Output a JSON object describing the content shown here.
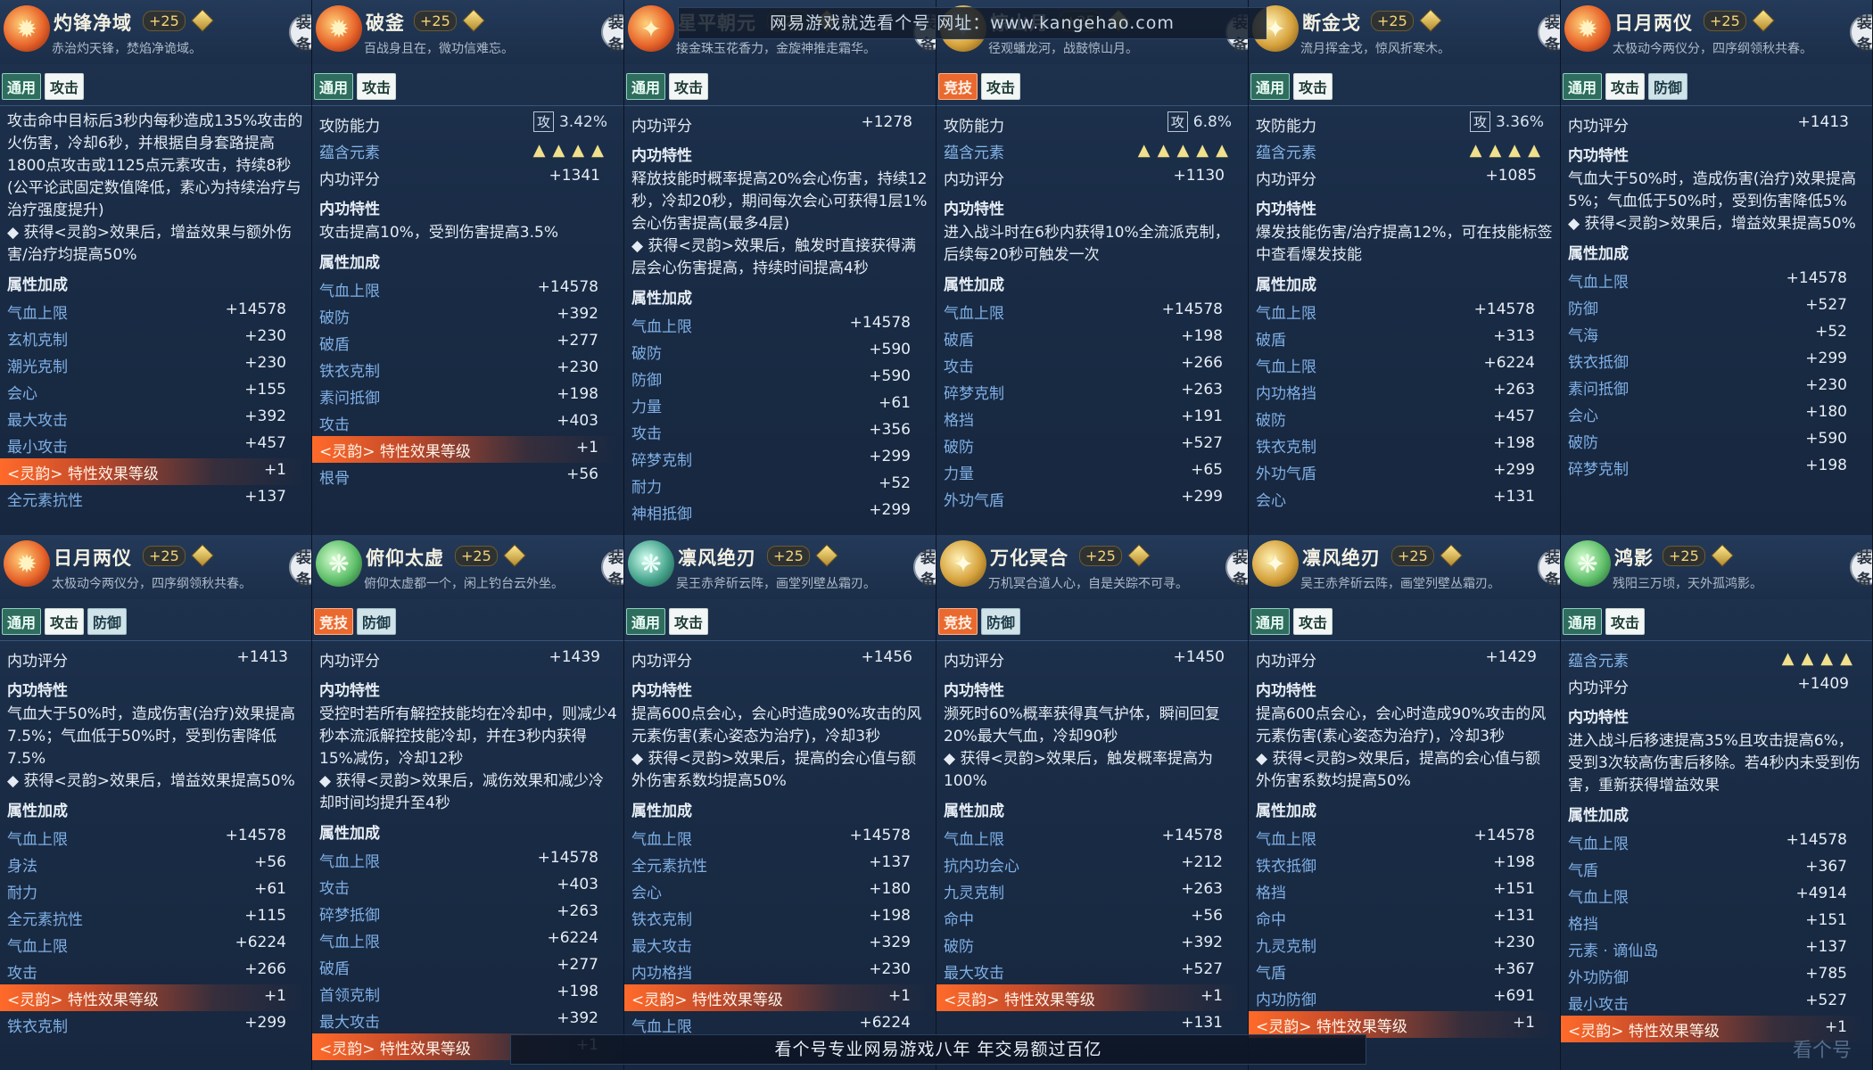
{
  "watermark_top": "网易游戏就选看个号  网址：www.kangehao.com",
  "watermark_bottom": "看个号专业网易游戏八年  年交易额过百亿",
  "corner_logo": "看个号",
  "equip_label": "装备",
  "panels": [
    {
      "title": "灼锋净域",
      "plus": "+25",
      "subtitle": "赤治灼天锋，焚焰净诡域。",
      "tags": [
        "通用",
        "攻击"
      ],
      "desc": "攻击命中目标后3秒内每秒造成135%攻击的火伤害，冷却6秒，并根据自身套路提高1800点攻击或1125点元素攻击，持续8秒(公平论武固定数值降低，素心为持续治疗与治疗强度提升)",
      "desc_extra": "◆ 获得<灵韵>效果后，增益效果与额外伤害/治疗均提高50%",
      "attr_header": "属性加成",
      "stats": [
        [
          "气血上限",
          "+14578"
        ],
        [
          "玄机克制",
          "+230"
        ],
        [
          "潮光克制",
          "+230"
        ],
        [
          "会心",
          "+155"
        ],
        [
          "最大攻击",
          "+392"
        ],
        [
          "最小攻击",
          "+457"
        ],
        [
          "<灵韵> 特性效果等级",
          "+1"
        ],
        [
          "全元素抗性",
          "+137"
        ]
      ]
    },
    {
      "title": "破釜",
      "plus": "+25",
      "subtitle": "百战身且在，微功信难忘。",
      "tags": [
        "通用",
        "攻击"
      ],
      "rating_label": "攻防能力",
      "rating_badge": "攻",
      "rating_value": "3.42%",
      "element_label": "蕴含元素",
      "element_stars": "▲▲▲▲",
      "score_label": "内功评分",
      "score_value": "+1341",
      "trait_label": "内功特性",
      "desc": "攻击提高10%，受到伤害提高3.5%",
      "attr_header": "属性加成",
      "stats": [
        [
          "气血上限",
          "+14578"
        ],
        [
          "破防",
          "+392"
        ],
        [
          "破盾",
          "+277"
        ],
        [
          "铁衣克制",
          "+230"
        ],
        [
          "素问抵御",
          "+198"
        ],
        [
          "攻击",
          "+403"
        ],
        [
          "<灵韵> 特性效果等级",
          "+1"
        ],
        [
          "根骨",
          "+56"
        ]
      ]
    },
    {
      "title": "星平朝元",
      "plus": "+25",
      "subtitle": "接金珠玉花香力，金旋神推走霜华。",
      "tags": [
        "通用",
        "攻击"
      ],
      "score_label": "内功评分",
      "score_value": "+1278",
      "trait_label": "内功特性",
      "desc": "释放技能时概率提高20%会心伤害，持续12秒，冷却20秒，期间每次会心可获得1层1%会心伤害提高(最多4层)",
      "desc_extra": "◆ 获得<灵韵>效果后，触发时直接获得满层会心伤害提高，持续时间提高4秒",
      "attr_header": "属性加成",
      "stats": [
        [
          "气血上限",
          "+14578"
        ],
        [
          "破防",
          "+590"
        ],
        [
          "防御",
          "+590"
        ],
        [
          "力量",
          "+61"
        ],
        [
          "攻击",
          "+356"
        ],
        [
          "碎梦克制",
          "+299"
        ],
        [
          "耐力",
          "+52"
        ],
        [
          "神相抵御",
          "+299"
        ]
      ]
    },
    {
      "title": "惊山月",
      "plus": "+25",
      "subtitle": "径观蟠龙河，战鼓惊山月。",
      "tags": [
        "竞技",
        "攻击"
      ],
      "rating_label": "攻防能力",
      "rating_badge": "攻",
      "rating_value": "6.8%",
      "element_label": "蕴含元素",
      "element_stars": "▲▲▲▲▲",
      "score_label": "内功评分",
      "score_value": "+1130",
      "trait_label": "内功特性",
      "desc": "进入战斗时在6秒内获得10%全流派克制，后续每20秒可触发一次",
      "attr_header": "属性加成",
      "stats": [
        [
          "气血上限",
          "+14578"
        ],
        [
          "破盾",
          "+198"
        ],
        [
          "攻击",
          "+266"
        ],
        [
          "碎梦克制",
          "+263"
        ],
        [
          "格挡",
          "+191"
        ],
        [
          "破防",
          "+527"
        ],
        [
          "力量",
          "+65"
        ],
        [
          "外功气盾",
          "+299"
        ]
      ]
    },
    {
      "title": "断金戈",
      "plus": "+25",
      "subtitle": "流月挥金戈，惊风折寒木。",
      "tags": [
        "通用",
        "攻击"
      ],
      "rating_label": "攻防能力",
      "rating_badge": "攻",
      "rating_value": "3.36%",
      "element_label": "蕴含元素",
      "element_stars": "▲▲▲▲",
      "score_label": "内功评分",
      "score_value": "+1085",
      "trait_label": "内功特性",
      "desc": "爆发技能伤害/治疗提高12%，可在技能标签中查看爆发技能",
      "attr_header": "属性加成",
      "stats": [
        [
          "气血上限",
          "+14578"
        ],
        [
          "破盾",
          "+313"
        ],
        [
          "气血上限",
          "+6224"
        ],
        [
          "内功格挡",
          "+263"
        ],
        [
          "破防",
          "+457"
        ],
        [
          "铁衣克制",
          "+198"
        ],
        [
          "外功气盾",
          "+299"
        ],
        [
          "会心",
          "+131"
        ]
      ]
    },
    {
      "title": "日月两仪",
      "plus": "+25",
      "subtitle": "太极动今两仪分，四序纲领秋共春。",
      "tags": [
        "通用",
        "攻击",
        "防御"
      ],
      "score_label": "内功评分",
      "score_value": "+1413",
      "trait_label": "内功特性",
      "desc": "气血大于50%时，造成伤害(治疗)效果提高5%；气血低于50%时，受到伤害降低5%",
      "desc_extra": "◆ 获得<灵韵>效果后，增益效果提高50%",
      "attr_header": "属性加成",
      "stats": [
        [
          "气血上限",
          "+14578"
        ],
        [
          "防御",
          "+527"
        ],
        [
          "气海",
          "+52"
        ],
        [
          "铁衣抵御",
          "+299"
        ],
        [
          "素问抵御",
          "+230"
        ],
        [
          "会心",
          "+180"
        ],
        [
          "破防",
          "+590"
        ],
        [
          "碎梦克制",
          "+198"
        ]
      ]
    },
    {
      "title": "日月两仪",
      "plus": "+25",
      "subtitle": "太极动今两仪分，四序纲领秋共春。",
      "tags": [
        "通用",
        "攻击",
        "防御"
      ],
      "score_label": "内功评分",
      "score_value": "+1413",
      "trait_label": "内功特性",
      "desc": "气血大于50%时，造成伤害(治疗)效果提高7.5%；气血低于50%时，受到伤害降低7.5%",
      "desc_extra": "◆ 获得<灵韵>效果后，增益效果提高50%",
      "attr_header": "属性加成",
      "stats": [
        [
          "气血上限",
          "+14578"
        ],
        [
          "身法",
          "+56"
        ],
        [
          "耐力",
          "+61"
        ],
        [
          "全元素抗性",
          "+115"
        ],
        [
          "气血上限",
          "+6224"
        ],
        [
          "攻击",
          "+266"
        ],
        [
          "<灵韵> 特性效果等级",
          "+1"
        ],
        [
          "铁衣克制",
          "+299"
        ]
      ]
    },
    {
      "title": "俯仰太虚",
      "plus": "+25",
      "subtitle": "俯仰太虚都一个，闲上钓台云外坐。",
      "tags": [
        "竞技",
        "防御"
      ],
      "score_label": "内功评分",
      "score_value": "+1439",
      "trait_label": "内功特性",
      "desc": "受控时若所有解控技能均在冷却中，则减少4秒本流派解控技能冷却，并在3秒内获得15%减伤，冷却12秒",
      "desc_extra": "◆ 获得<灵韵>效果后，减伤效果和减少冷却时间均提升至4秒",
      "attr_header": "属性加成",
      "stats": [
        [
          "气血上限",
          "+14578"
        ],
        [
          "攻击",
          "+403"
        ],
        [
          "碎梦抵御",
          "+263"
        ],
        [
          "气血上限",
          "+6224"
        ],
        [
          "破盾",
          "+277"
        ],
        [
          "首领克制",
          "+198"
        ],
        [
          "最大攻击",
          "+392"
        ],
        [
          "<灵韵> 特性效果等级",
          "+1"
        ]
      ]
    },
    {
      "title": "凛风绝刃",
      "plus": "+25",
      "subtitle": "吴王赤斧斫云阵，画堂列壁丛霜刃。",
      "tags": [
        "通用",
        "攻击"
      ],
      "score_label": "内功评分",
      "score_value": "+1456",
      "trait_label": "内功特性",
      "desc": "提高600点会心，会心时造成90%攻击的风元素伤害(素心姿态为治疗)，冷却3秒",
      "desc_extra": "◆ 获得<灵韵>效果后，提高的会心值与额外伤害系数均提高50%",
      "attr_header": "属性加成",
      "stats": [
        [
          "气血上限",
          "+14578"
        ],
        [
          "全元素抗性",
          "+137"
        ],
        [
          "会心",
          "+180"
        ],
        [
          "铁衣克制",
          "+198"
        ],
        [
          "最大攻击",
          "+329"
        ],
        [
          "内功格挡",
          "+230"
        ],
        [
          "<灵韵> 特性效果等级",
          "+1"
        ],
        [
          "气血上限",
          "+6224"
        ]
      ]
    },
    {
      "title": "万化冥合",
      "plus": "+25",
      "subtitle": "万机冥合道人心，自是关踪不可寻。",
      "tags": [
        "竞技",
        "防御"
      ],
      "score_label": "内功评分",
      "score_value": "+1450",
      "trait_label": "内功特性",
      "desc": "濒死时60%概率获得真气护体，瞬间回复20%最大气血，冷却90秒",
      "desc_extra": "◆ 获得<灵韵>效果后，触发概率提高为100%",
      "attr_header": "属性加成",
      "stats": [
        [
          "气血上限",
          "+14578"
        ],
        [
          "抗内功会心",
          "+212"
        ],
        [
          "九灵克制",
          "+263"
        ],
        [
          "命中",
          "+56"
        ],
        [
          "破防",
          "+392"
        ],
        [
          "最大攻击",
          "+527"
        ],
        [
          "<灵韵> 特性效果等级",
          "+1"
        ],
        [
          "",
          "+131"
        ]
      ]
    },
    {
      "title": "凛风绝刃",
      "plus": "+25",
      "subtitle": "吴王赤斧斫云阵，画堂列壁丛霜刃。",
      "tags": [
        "通用",
        "攻击"
      ],
      "score_label": "内功评分",
      "score_value": "+1429",
      "trait_label": "内功特性",
      "desc": "提高600点会心，会心时造成90%攻击的风元素伤害(素心姿态为治疗)，冷却3秒",
      "desc_extra": "◆ 获得<灵韵>效果后，提高的会心值与额外伤害系数均提高50%",
      "attr_header": "属性加成",
      "stats": [
        [
          "气血上限",
          "+14578"
        ],
        [
          "铁衣抵御",
          "+198"
        ],
        [
          "格挡",
          "+151"
        ],
        [
          "命中",
          "+131"
        ],
        [
          "九灵克制",
          "+230"
        ],
        [
          "气盾",
          "+367"
        ],
        [
          "内功防御",
          "+691"
        ],
        [
          "<灵韵> 特性效果等级",
          "+1"
        ]
      ]
    },
    {
      "title": "鸿影",
      "plus": "+25",
      "subtitle": "残阳三万顷，天外孤鸿影。",
      "tags": [
        "通用",
        "攻击"
      ],
      "element_label": "蕴含元素",
      "element_stars": "▲▲▲▲",
      "score_label": "内功评分",
      "score_value": "+1409",
      "trait_label": "内功特性",
      "desc": "进入战斗后移速提高35%且攻击提高6%，受到3次较高伤害后移除。若4秒内未受到伤害，重新获得增益效果",
      "attr_header": "属性加成",
      "stats": [
        [
          "气血上限",
          "+14578"
        ],
        [
          "气盾",
          "+367"
        ],
        [
          "气血上限",
          "+4914"
        ],
        [
          "格挡",
          "+151"
        ],
        [
          "元素 · 谪仙岛",
          "+137"
        ],
        [
          "外功防御",
          "+785"
        ],
        [
          "最小攻击",
          "+527"
        ],
        [
          "<灵韵> 特性效果等级",
          "+1"
        ]
      ]
    }
  ]
}
